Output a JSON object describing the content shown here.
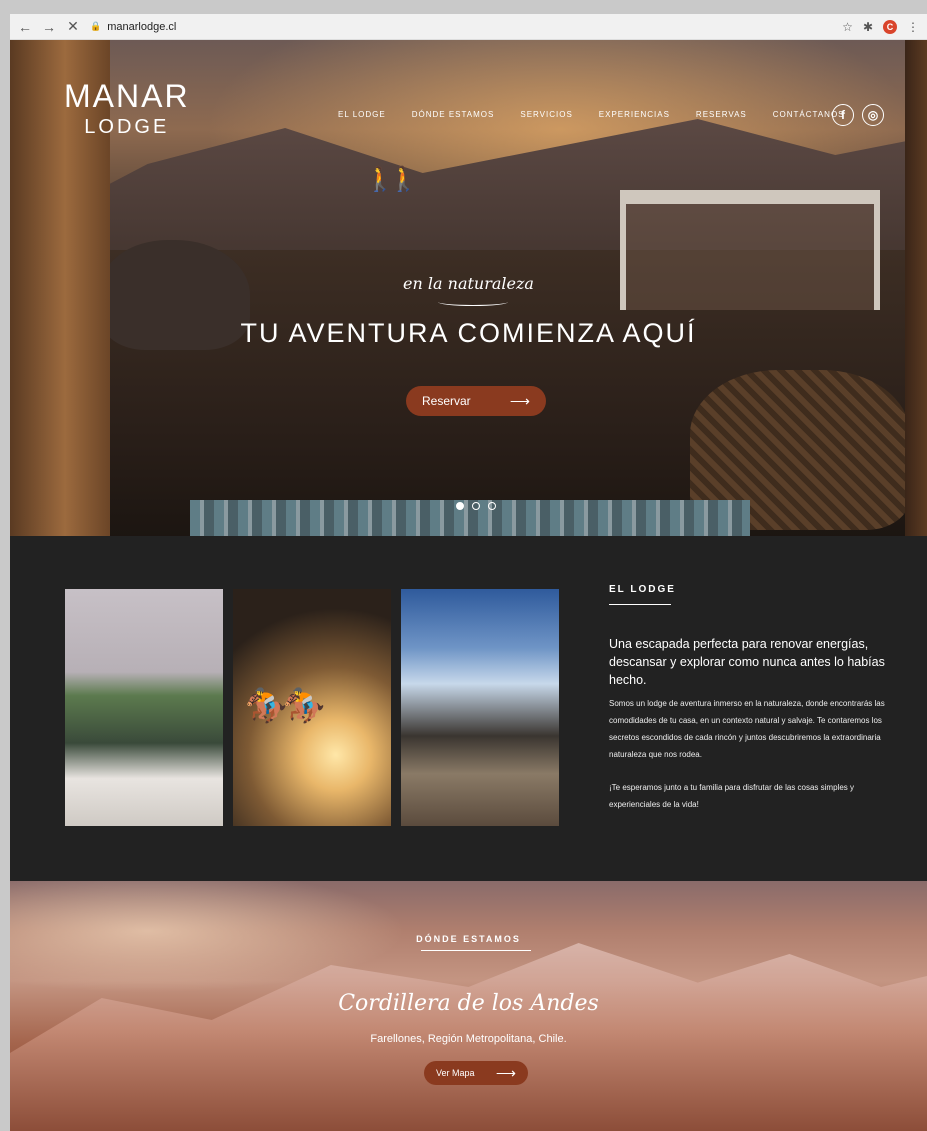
{
  "browser": {
    "back": "←",
    "forward": "→",
    "reload": "✕",
    "lock": "🔒",
    "url": "manarlodge.cl",
    "star": "☆",
    "extensions": "✱",
    "avatar_letter": "C",
    "menu": "⋮"
  },
  "logo": {
    "line1": "MANAR",
    "line2": "LODGE"
  },
  "nav": {
    "items": [
      "EL LODGE",
      "DÓNDE ESTAMOS",
      "SERVICIOS",
      "EXPERIENCIAS",
      "RESERVAS",
      "CONTÁCTANOS"
    ]
  },
  "social": {
    "facebook": "f",
    "instagram": "◎"
  },
  "hero": {
    "script": "en la naturaleza",
    "headline": "TU AVENTURA COMIENZA AQUÍ",
    "button_label": "Reservar",
    "button_arrow": "⟶",
    "slides": 3,
    "active_slide": 1
  },
  "lodge": {
    "title": "EL LODGE",
    "lead": "Una escapada perfecta para renovar energías, descansar y explorar como nunca antes lo habías hecho.",
    "body1": "Somos un lodge de aventura inmerso en la naturaleza, donde encontrarás las comodidades de tu casa, en un contexto natural y salvaje. Te contaremos los secretos escondidos de cada rincón y juntos descubriremos la extraordinaria naturaleza que nos rodea.",
    "body2": "¡Te esperamos junto a tu familia para disfrutar de las cosas simples y experienciales de la vida!"
  },
  "where": {
    "title": "DÓNDE ESTAMOS",
    "script": "Cordillera de los Andes",
    "subtitle": "Farellones, Región Metropolitana, Chile.",
    "button_label": "Ver Mapa",
    "button_arrow": "⟶"
  },
  "colors": {
    "accent": "#8a3a1f",
    "dark_section": "#222222"
  }
}
